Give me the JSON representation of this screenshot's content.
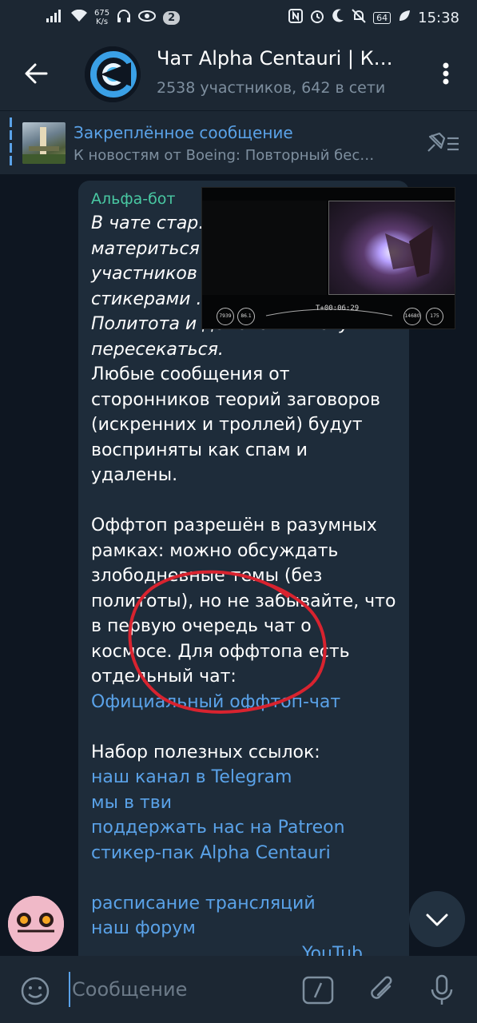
{
  "status_bar": {
    "net_speed_value": "675",
    "net_speed_unit": "K/s",
    "notification_count": "2",
    "battery": "64",
    "time": "15:38"
  },
  "header": {
    "title": "Чат Alpha Centauri | К…",
    "subtitle": "2538 участников, 642 в сети"
  },
  "pinned": {
    "title": "Закреплённое сообщение",
    "text": "К новостям от Boeing:  Повторный бес…"
  },
  "message": {
    "sender": "Альфа-бот",
    "italic_lines": [
      "В чате стар…",
      "материться",
      "участников",
      "стикерами …",
      "Политота и демагогия могут",
      "пересекаться."
    ],
    "para1": "Любые сообщения от сторонников теорий заговоров (искренних и троллей) будут восприняты как спам и удалены.",
    "para2": "Оффтоп разрешён в разумных рамках: можно обсуждать злободневные темы (без политоты), но не забывайте, что в первую очередь чат о космосе. Для оффтопа есть отдельный чат:",
    "offtop_link": "Официальный оффтоп-чат",
    "links_heading": "Набор полезных ссылок:",
    "links": [
      "наш канал в Telegram",
      "мы в тви",
      "поддержать нас на Patreon",
      "стикер-пак Alpha Centauri"
    ],
    "links2": [
      "расписание трансляций",
      "наш форум",
      "YouTub…"
    ]
  },
  "video_overlay": {
    "timer": "T+00:06:29",
    "left_dial_1": "7939",
    "left_dial_2": "86.1",
    "right_dial_1": "14680",
    "right_dial_2": "175"
  },
  "input": {
    "placeholder": "Сообщение"
  },
  "colors": {
    "background": "#0e1621",
    "bar": "#1c2733",
    "bubble": "#1e2c3a",
    "accent": "#5aa2e8",
    "sender": "#49c9a3",
    "annotation": "#d8232f"
  }
}
